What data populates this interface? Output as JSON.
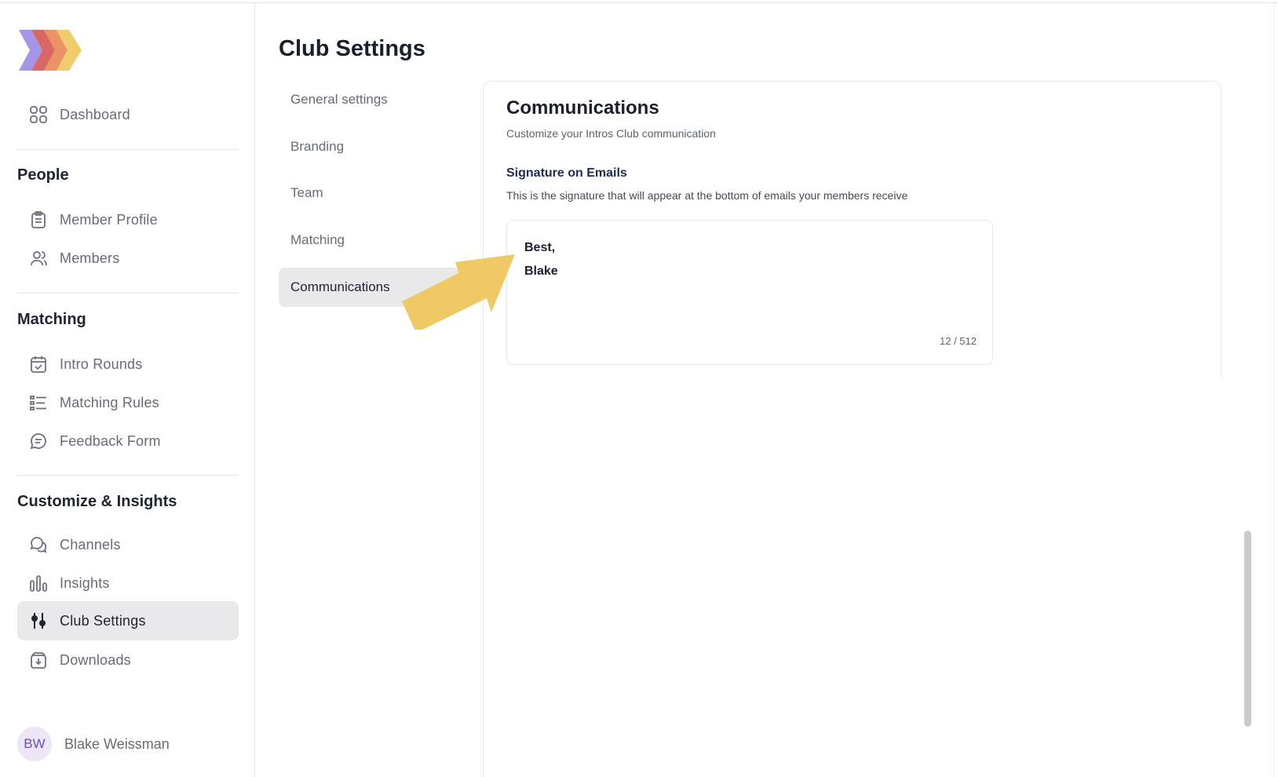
{
  "sidebar": {
    "dashboard": "Dashboard",
    "sections": {
      "people": "People",
      "matching": "Matching",
      "customize": "Customize & Insights"
    },
    "items": {
      "member_profile": "Member Profile",
      "members": "Members",
      "intro_rounds": "Intro Rounds",
      "matching_rules": "Matching Rules",
      "feedback_form": "Feedback Form",
      "channels": "Channels",
      "insights": "Insights",
      "club_settings": "Club Settings",
      "downloads": "Downloads"
    },
    "active": "Club Settings",
    "user": {
      "initials": "BW",
      "name": "Blake Weissman"
    }
  },
  "page": {
    "title": "Club Settings"
  },
  "settings_nav": {
    "items": [
      "General settings",
      "Branding",
      "Team",
      "Matching",
      "Communications"
    ],
    "active": "Communications"
  },
  "communications": {
    "title": "Communications",
    "subtitle": "Customize your Intros Club communication",
    "signature": {
      "title": "Signature on Emails",
      "description": "This is the signature that will appear at the bottom of emails your members receive",
      "lines": [
        "Best,",
        "Blake"
      ],
      "counter": "12 / 512"
    }
  },
  "colors": {
    "accent_arrow": "#efc964",
    "active_bg": "#e9e9ec",
    "logo": [
      "#a18ee6",
      "#d65b57",
      "#e88a58",
      "#f0c964"
    ]
  },
  "icons": {
    "dashboard": "grid-icon",
    "member_profile": "clipboard-icon",
    "members": "users-icon",
    "intro_rounds": "calendar-check-icon",
    "matching_rules": "list-icon",
    "feedback_form": "message-icon",
    "channels": "chat-bubbles-icon",
    "insights": "bar-chart-icon",
    "club_settings": "sliders-icon",
    "downloads": "download-box-icon"
  }
}
